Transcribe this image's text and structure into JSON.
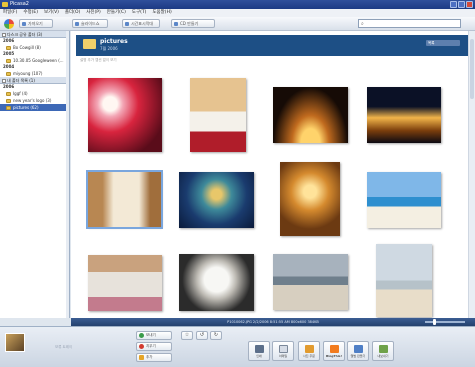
{
  "window": {
    "title": "Picasa2"
  },
  "menu": [
    "파일(F)",
    "수정(E)",
    "보기(V)",
    "폴더(O)",
    "사진(P)",
    "만들기(C)",
    "도구(T)",
    "도움말(H)"
  ],
  "toolbar": {
    "import_label": "가져오기",
    "slideshow_label": "슬라이드쇼",
    "timeline_label": "시간표시막대",
    "cd_label": "CD 만들기",
    "search_placeholder": ""
  },
  "sidebar": {
    "section1_label": "다스크 공유 폴더 (3)",
    "section2_label": "내 폴더 목록 (1)",
    "years": [
      {
        "year": "2006",
        "items": [
          "Bo Cowgill (8)"
        ]
      },
      {
        "year": "2005",
        "items": [
          "10.30.05 Googleween (..."
        ]
      },
      {
        "year": "2004",
        "items": [
          "miyoung (107)"
        ]
      },
      {
        "year": "2006",
        "items": [
          "Iggf (4)",
          "new year's logo (3)",
          "pictures (62)"
        ]
      }
    ]
  },
  "main": {
    "title": "pictures",
    "date": "7월 2006",
    "subtitle": "설명 추가 캡션 없이 보기",
    "view_select": "목록"
  },
  "status": {
    "text": "P1010062.JPG  2/2/2006 8:51:55 AM  800x600   384KB"
  },
  "tray": {
    "hold_label": "보류 트레이",
    "share_label": "보내기",
    "clear_label": "지우기",
    "add_label": "추가"
  },
  "actions": [
    "인쇄",
    "이메일",
    "사진 주문",
    "BlogThis!",
    "앨범 만들기",
    "내보내기"
  ],
  "colors": {
    "accent": "#1d4f85",
    "selected": "#3d68b6",
    "highlight": "#7aa6dd"
  }
}
